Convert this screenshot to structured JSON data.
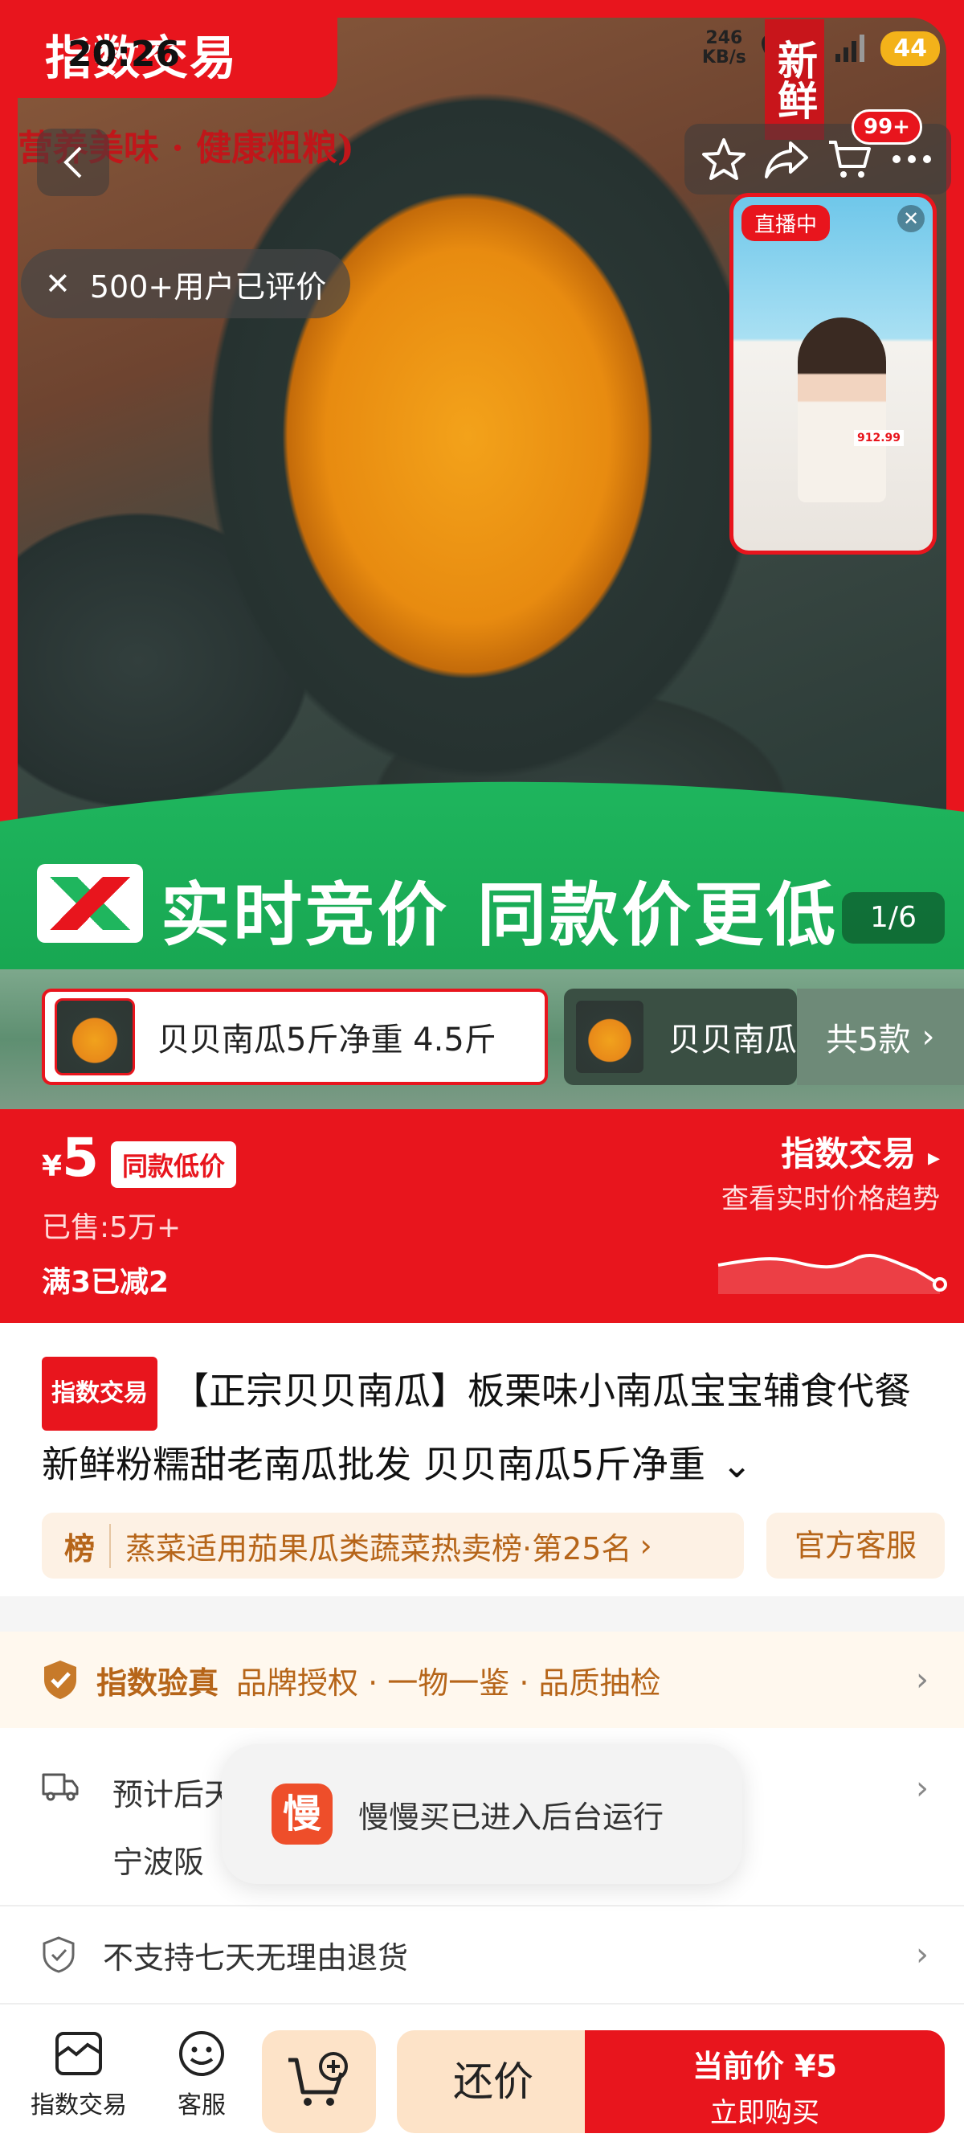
{
  "status": {
    "time": "20:26",
    "net_speed": "246\nKB/s",
    "network": "5G",
    "battery": "44"
  },
  "hero": {
    "brand_tag": "指数交易",
    "subtitle": "营养美味 · 健康粗粮)",
    "fresh_tag": "新鲜",
    "cart_badge": "99+",
    "review_pill": "500+用户已评价",
    "live_badge": "直播中",
    "live_price": "912.99",
    "banner_text": "实时竞价 同款价更低",
    "page_indicator": "1/6"
  },
  "variants": {
    "selected_label": "贝贝南瓜5斤净重 4.5斤",
    "second_label": "贝贝南瓜",
    "count_label": "共5款"
  },
  "price": {
    "currency": "¥",
    "amount": "5",
    "same_low": "同款低价",
    "sold": "已售:5万+",
    "promo": "满3已减2",
    "index_title": "指数交易",
    "index_sub": "查看实时价格趋势"
  },
  "title": {
    "tag": "指数交易",
    "text": "【正宗贝贝南瓜】板栗味小南瓜宝宝辅食代餐新鲜粉糯甜老南瓜批发 贝贝南瓜5斤净重",
    "rank_first": "榜",
    "rank_text": "蒸菜适用茄果瓜类蔬菜热卖榜·第25名",
    "customer_service": "官方客服"
  },
  "verify": {
    "title": "指数验真",
    "desc": "品牌授权 · 一物一鉴 · 品质抽检"
  },
  "shipping": {
    "line1": "预计后天",
    "line2": "宁波阪"
  },
  "return_policy": "不支持七天无理由退货",
  "toast": {
    "icon": "慢",
    "text": "慢慢买已进入后台运行"
  },
  "bottom": {
    "tab1": "指数交易",
    "tab2": "客服",
    "bargain": "还价",
    "buy_line1": "当前价 ¥5",
    "buy_line2": "立即购买"
  },
  "colors": {
    "brand_red": "#e8151d",
    "banner_green": "#1fb65e",
    "beige": "#fde3c8"
  }
}
